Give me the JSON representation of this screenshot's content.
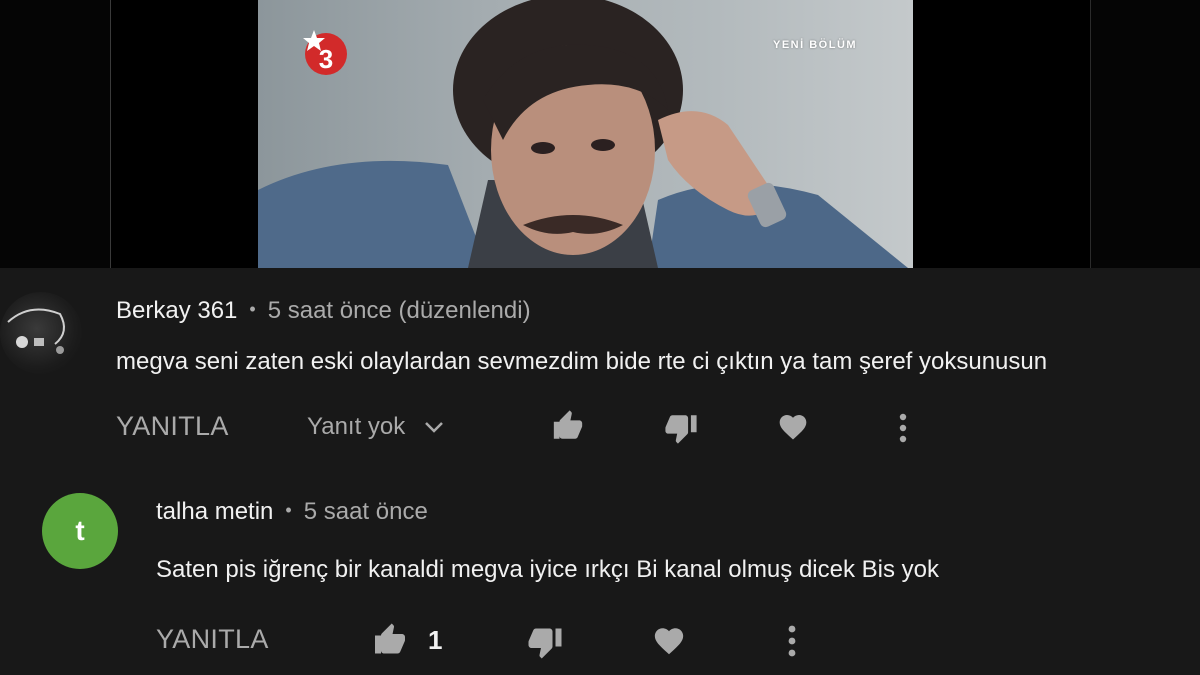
{
  "video": {
    "channel_logo_icon": "star-tv-logo",
    "caption": "YENİ BÖLÜM"
  },
  "comments": [
    {
      "author": "Berkay 361",
      "time": "5 saat önce (düzenlendi)",
      "text": "megva seni zaten eski olaylardan sevmezdim bide rte ci çıktın ya tam şeref yoksunusun",
      "reply_label": "YANITLA",
      "replies_label": "Yanıt yok",
      "like_count": ""
    },
    {
      "author": "talha metin",
      "avatar_letter": "t",
      "avatar_color": "#5aa63d",
      "time": "5 saat önce",
      "text": "Saten pis iğrenç bir kanaldi megva iyice ırkçı Bi kanal olmuş dicek Bis yok",
      "reply_label": "YANITLA",
      "like_count": "1"
    }
  ],
  "separator": "•",
  "colors": {
    "background": "#181818",
    "text_primary": "#f1f1f1",
    "text_secondary": "#aaaaaa",
    "avatar_green": "#5aa63d"
  }
}
